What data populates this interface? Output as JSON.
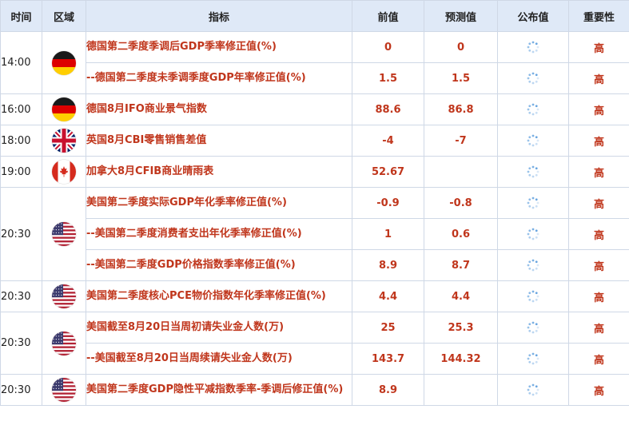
{
  "headers": {
    "time": "时间",
    "region": "区域",
    "indicator": "指标",
    "previous": "前值",
    "forecast": "预测值",
    "actual": "公布值",
    "importance": "重要性"
  },
  "groups": [
    {
      "time": "14:00",
      "flag": "germany-flag-icon",
      "rows": [
        {
          "indicator": "德国第二季度季调后GDP季率修正值(%)",
          "previous": "0",
          "forecast": "0",
          "importance": "高"
        },
        {
          "indicator": "--德国第二季度未季调季度GDP年率修正值(%)",
          "previous": "1.5",
          "forecast": "1.5",
          "importance": "高"
        }
      ]
    },
    {
      "time": "16:00",
      "flag": "germany-flag-icon",
      "rows": [
        {
          "indicator": "德国8月IFO商业景气指数",
          "previous": "88.6",
          "forecast": "86.8",
          "importance": "高"
        }
      ]
    },
    {
      "time": "18:00",
      "flag": "uk-flag-icon",
      "rows": [
        {
          "indicator": "英国8月CBI零售销售差值",
          "previous": "-4",
          "forecast": "-7",
          "importance": "高"
        }
      ]
    },
    {
      "time": "19:00",
      "flag": "canada-flag-icon",
      "rows": [
        {
          "indicator": "加拿大8月CFIB商业晴雨表",
          "previous": "52.67",
          "forecast": "",
          "importance": "高"
        }
      ]
    },
    {
      "time": "20:30",
      "flag": "usa-flag-icon",
      "rows": [
        {
          "indicator": "美国第二季度实际GDP年化季率修正值(%)",
          "previous": "-0.9",
          "forecast": "-0.8",
          "importance": "高"
        },
        {
          "indicator": "--美国第二季度消费者支出年化季率修正值(%)",
          "previous": "1",
          "forecast": "0.6",
          "importance": "高"
        },
        {
          "indicator": "--美国第二季度GDP价格指数季率修正值(%)",
          "previous": "8.9",
          "forecast": "8.7",
          "importance": "高"
        }
      ]
    },
    {
      "time": "20:30",
      "flag": "usa-flag-icon",
      "rows": [
        {
          "indicator": "美国第二季度核心PCE物价指数年化季率修正值(%)",
          "previous": "4.4",
          "forecast": "4.4",
          "importance": "高"
        }
      ]
    },
    {
      "time": "20:30",
      "flag": "usa-flag-icon",
      "rows": [
        {
          "indicator": "美国截至8月20日当周初请失业金人数(万)",
          "previous": "25",
          "forecast": "25.3",
          "importance": "高"
        },
        {
          "indicator": "--美国截至8月20日当周续请失业金人数(万)",
          "previous": "143.7",
          "forecast": "144.32",
          "importance": "高"
        }
      ]
    },
    {
      "time": "20:30",
      "flag": "usa-flag-icon",
      "rows": [
        {
          "indicator": "美国第二季度GDP隐性平减指数季率-季调后修正值(%)",
          "previous": "8.9",
          "forecast": "",
          "importance": "高"
        }
      ]
    }
  ],
  "colors": {
    "header_bg": "#dfe9f7",
    "border": "#cfd8e6",
    "value_red": "#c0361c",
    "loading_blue": "#6aa6e0"
  }
}
